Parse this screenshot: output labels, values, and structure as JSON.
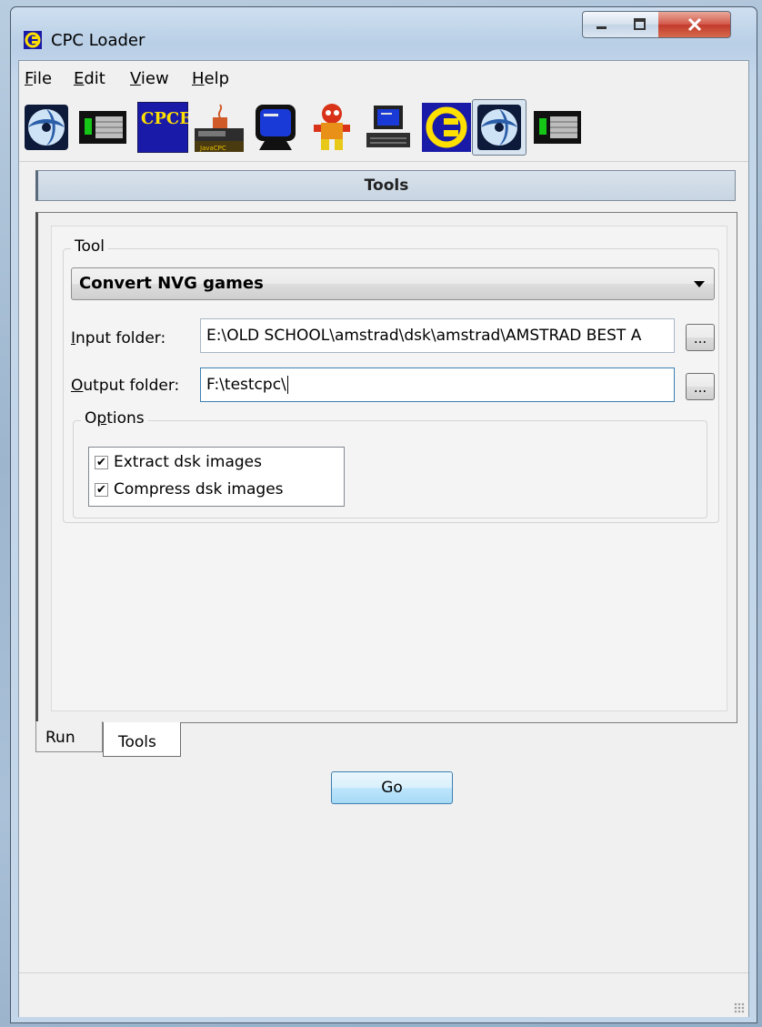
{
  "window": {
    "title": "CPC Loader"
  },
  "menu": [
    {
      "label": "File",
      "accel": "F",
      "rest": "ile"
    },
    {
      "label": "Edit",
      "accel": "E",
      "rest": "dit"
    },
    {
      "label": "View",
      "accel": "V",
      "rest": "iew"
    },
    {
      "label": "Help",
      "accel": "H",
      "rest": "elp"
    }
  ],
  "toolbar": {
    "items": [
      {
        "icon": "winape-icon"
      },
      {
        "icon": "cpc-keyboard-icon"
      },
      {
        "icon": "cpce-icon",
        "text": "CPCE"
      },
      {
        "icon": "javacpc-icon",
        "text": "JavaCPC"
      },
      {
        "icon": "monitor-icon"
      },
      {
        "icon": "character-icon"
      },
      {
        "icon": "computer-icon"
      },
      {
        "icon": "cpc-logo-icon"
      },
      {
        "icon": "winape-icon",
        "active": true
      },
      {
        "icon": "cpc-keyboard-icon"
      }
    ]
  },
  "header": {
    "title": "Tools"
  },
  "tool": {
    "legend": "Tool",
    "selected": "Convert NVG games",
    "input_label_accel": "I",
    "input_label_rest": "nput folder:",
    "input_value": "E:\\OLD SCHOOL\\amstrad\\dsk\\amstrad\\AMSTRAD BEST A",
    "output_label_accel": "O",
    "output_label_rest": "utput folder:",
    "output_value": "F:\\testcpc\\",
    "browse_label": "...",
    "options_legend_pre": "O",
    "options_legend_accel": "p",
    "options_legend_rest": "tions",
    "options": [
      {
        "label": "Extract dsk images",
        "checked": true
      },
      {
        "label": "Compress dsk images",
        "checked": true
      }
    ]
  },
  "tabs": [
    {
      "label": "Run",
      "selected": false
    },
    {
      "label": "Tools",
      "selected": true
    }
  ],
  "go_label": "Go",
  "colors": {
    "header_bg": "#c8d5e2",
    "go_button": "#bee6fd",
    "close_button": "#c23a2b"
  }
}
